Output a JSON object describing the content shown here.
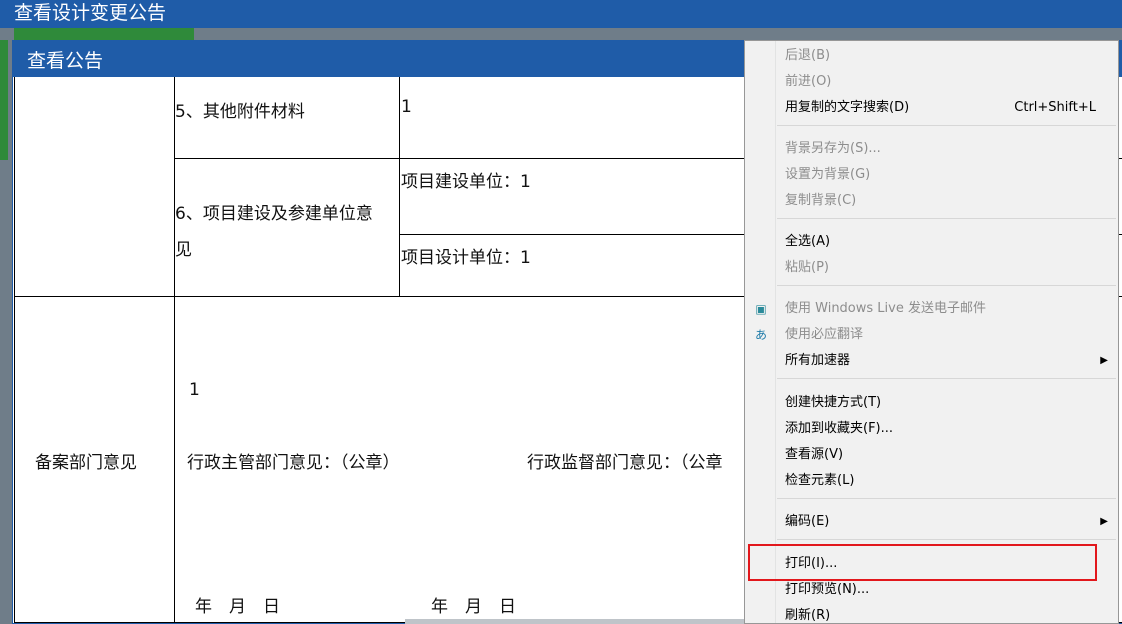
{
  "window": {
    "title": "查看设计变更公告"
  },
  "dialog": {
    "title": "查看公告"
  },
  "form": {
    "row5_label": "5、其他附件材料",
    "row5_value": "1",
    "row6_label_line1": "6、项目建设及参建单位意",
    "row6_label_line2": "见",
    "construction_unit_label": "项目建设单位：",
    "construction_unit_value": "1",
    "design_unit_label": "项目设计单位：",
    "design_unit_value": "1",
    "filing_dept_label": "备案部门意见",
    "filing_value": "1",
    "admin_dept_opinion": "行政主管部门意见：（公章）",
    "supervision_dept_opinion": "行政监督部门意见：（公章",
    "date1": "年　月　日",
    "date2": "年　月　日"
  },
  "context_menu": {
    "items": [
      {
        "label": "后退(B)",
        "disabled": true
      },
      {
        "label": "前进(O)",
        "disabled": true
      },
      {
        "label": "用复制的文字搜索(D)",
        "shortcut": "Ctrl+Shift+L"
      },
      {
        "label": "背景另存为(S)...",
        "disabled": true
      },
      {
        "label": "设置为背景(G)",
        "disabled": true
      },
      {
        "label": "复制背景(C)",
        "disabled": true
      },
      {
        "label": "全选(A)"
      },
      {
        "label": "粘贴(P)",
        "disabled": true
      },
      {
        "label": "使用 Windows Live 发送电子邮件",
        "disabled": true,
        "icon": "windows-live-mail-icon"
      },
      {
        "label": "使用必应翻译",
        "disabled": true,
        "icon": "bing-translate-icon"
      },
      {
        "label": "所有加速器",
        "submenu": true
      },
      {
        "label": "创建快捷方式(T)"
      },
      {
        "label": "添加到收藏夹(F)..."
      },
      {
        "label": "查看源(V)"
      },
      {
        "label": "检查元素(L)"
      },
      {
        "label": "编码(E)",
        "submenu": true
      },
      {
        "label": "打印(I)..."
      },
      {
        "label": "打印预览(N)..."
      },
      {
        "label": "刷新(R)"
      }
    ]
  }
}
